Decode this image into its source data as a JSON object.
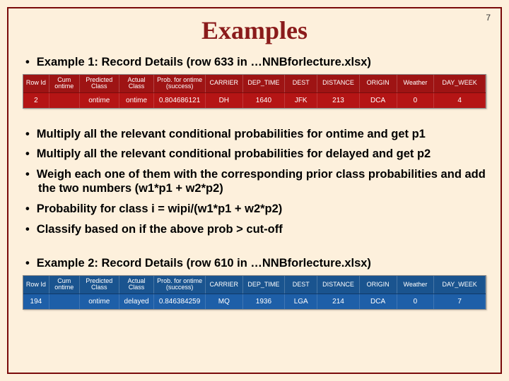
{
  "page_number": "7",
  "title": "Examples",
  "bullets": {
    "ex1_heading": "Example 1: Record Details (row 633 in …NNBforlecture.xlsx)",
    "b1": "Multiply all the relevant conditional probabilities for ontime and get p1",
    "b2": "Multiply all the relevant conditional probabilities for delayed and get p2",
    "b3": "Weigh each one of them with the corresponding prior class probabilities and add the two numbers (w1*p1 + w2*p2)",
    "b4": "Probability for class i = wipi/(w1*p1 + w2*p2)",
    "b5": "Classify based on if the above prob > cut-off",
    "ex2_heading": "Example 2: Record Details  (row 610 in …NNBforlecture.xlsx)"
  },
  "table_headers": {
    "h0": "Row Id",
    "h1": "Cum ontime",
    "h2": "Predicted Class",
    "h3": "Actual Class",
    "h4": "Prob. for ontime (success)",
    "h5": "CARRIER",
    "h6": "DEP_TIME",
    "h7": "DEST",
    "h8": "DISTANCE",
    "h9": "ORIGIN",
    "h10": "Weather",
    "h11": "DAY_WEEK"
  },
  "row1": {
    "c0": "2",
    "c1": "",
    "c2": "ontime",
    "c3": "ontime",
    "c4": "0.804686121",
    "c5": "DH",
    "c6": "1640",
    "c7": "JFK",
    "c8": "213",
    "c9": "DCA",
    "c10": "0",
    "c11": "4"
  },
  "row2": {
    "c0": "194",
    "c1": "",
    "c2": "ontime",
    "c3": "delayed",
    "c4": "0.846384259",
    "c5": "MQ",
    "c6": "1936",
    "c7": "LGA",
    "c8": "214",
    "c9": "DCA",
    "c10": "0",
    "c11": "7"
  },
  "colors": {
    "title": "#8a1b1b",
    "border": "#7a0b0b",
    "red_row": "#b51515",
    "blue_row": "#1e5fa8",
    "background": "#fdf0dc"
  }
}
